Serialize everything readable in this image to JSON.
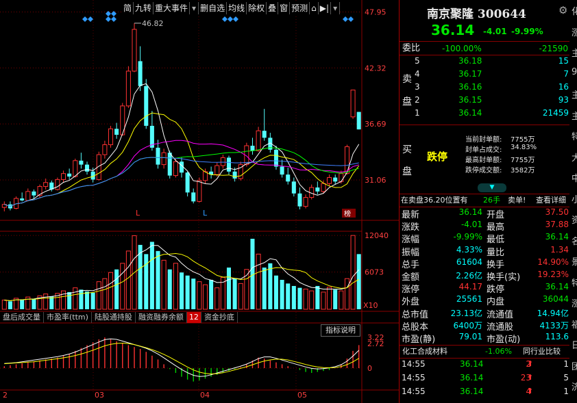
{
  "toolbar": {
    "items": [
      "简",
      "九转",
      "重大事件",
      "删自选",
      "均线",
      "除权",
      "叠",
      "窗",
      "预测"
    ]
  },
  "chart_data": {
    "type": "candlestick",
    "price_axis": {
      "labels": [
        "47.95",
        "42.32",
        "36.69",
        "31.06"
      ],
      "range": [
        27.0,
        48.6
      ]
    },
    "high_marker": "46.82",
    "volume_axis": {
      "labels": [
        "12040",
        "6073",
        "X10"
      ]
    },
    "indicator_axis": {
      "labels": [
        "3.22",
        "2.72",
        "0"
      ]
    },
    "x_labels": [
      "2",
      "03",
      "04",
      "05"
    ],
    "markers_L": [
      "L",
      "L"
    ],
    "corner_tag": "榜",
    "candles": [
      [
        28.3,
        28.9,
        27.9,
        28.6
      ],
      [
        28.6,
        28.9,
        28.0,
        28.2
      ],
      [
        28.2,
        29.4,
        28.1,
        29.2
      ],
      [
        29.2,
        29.8,
        28.9,
        29.0
      ],
      [
        29.0,
        30.2,
        28.9,
        29.9
      ],
      [
        29.9,
        30.1,
        29.2,
        29.5
      ],
      [
        29.5,
        30.6,
        29.3,
        30.4
      ],
      [
        30.4,
        31.2,
        30.1,
        30.8
      ],
      [
        30.8,
        31.0,
        29.9,
        30.1
      ],
      [
        30.1,
        31.3,
        30.0,
        31.1
      ],
      [
        31.1,
        32.0,
        30.8,
        31.7
      ],
      [
        31.7,
        32.2,
        31.1,
        31.4
      ],
      [
        31.4,
        33.2,
        31.3,
        33.0
      ],
      [
        33.0,
        33.8,
        32.2,
        32.6
      ],
      [
        32.6,
        32.9,
        31.6,
        31.9
      ],
      [
        31.9,
        32.3,
        30.8,
        31.1
      ],
      [
        31.1,
        33.9,
        31.0,
        33.6
      ],
      [
        33.6,
        35.0,
        33.2,
        34.6
      ],
      [
        34.6,
        36.5,
        34.3,
        36.2
      ],
      [
        36.2,
        36.8,
        35.2,
        35.6
      ],
      [
        35.6,
        38.8,
        35.5,
        38.5
      ],
      [
        38.5,
        42.5,
        38.3,
        42.0
      ],
      [
        42.0,
        46.82,
        41.9,
        46.2
      ],
      [
        43.0,
        44.5,
        40.0,
        40.5
      ],
      [
        40.5,
        41.2,
        36.2,
        36.5
      ],
      [
        36.5,
        38.0,
        34.0,
        34.3
      ],
      [
        34.3,
        35.1,
        32.2,
        32.6
      ],
      [
        32.6,
        34.2,
        32.2,
        33.8
      ],
      [
        33.8,
        34.0,
        31.2,
        31.5
      ],
      [
        31.5,
        33.2,
        31.3,
        32.9
      ],
      [
        32.9,
        33.3,
        31.3,
        31.8
      ],
      [
        31.8,
        31.9,
        29.4,
        29.8
      ],
      [
        29.8,
        30.2,
        28.7,
        28.9
      ],
      [
        28.9,
        31.3,
        28.8,
        31.0
      ],
      [
        31.0,
        32.2,
        30.7,
        31.9
      ],
      [
        31.9,
        32.4,
        31.2,
        31.6
      ],
      [
        31.6,
        32.8,
        31.4,
        32.5
      ],
      [
        32.5,
        33.6,
        32.2,
        33.3
      ],
      [
        33.3,
        33.5,
        31.6,
        31.9
      ],
      [
        31.9,
        32.3,
        30.9,
        31.2
      ],
      [
        31.2,
        32.9,
        31.0,
        32.6
      ],
      [
        32.6,
        34.8,
        32.4,
        34.5
      ],
      [
        34.5,
        35.3,
        33.6,
        34.0
      ],
      [
        34.0,
        36.4,
        33.9,
        36.0
      ],
      [
        36.0,
        38.2,
        35.0,
        35.3
      ],
      [
        35.3,
        35.8,
        33.8,
        34.1
      ],
      [
        34.1,
        34.5,
        32.1,
        32.4
      ],
      [
        32.4,
        33.1,
        31.3,
        31.6
      ],
      [
        31.6,
        32.3,
        30.6,
        30.9
      ],
      [
        30.9,
        31.3,
        29.4,
        29.7
      ],
      [
        29.7,
        30.3,
        28.1,
        28.4
      ],
      [
        28.4,
        29.6,
        28.2,
        29.3
      ],
      [
        29.3,
        30.6,
        29.1,
        30.3
      ],
      [
        30.3,
        30.9,
        29.6,
        29.9
      ],
      [
        29.9,
        31.0,
        29.7,
        30.7
      ],
      [
        30.7,
        31.6,
        30.4,
        31.3
      ],
      [
        31.3,
        31.6,
        30.6,
        30.9
      ],
      [
        30.9,
        32.0,
        30.7,
        31.7
      ],
      [
        31.7,
        34.6,
        31.6,
        34.4
      ],
      [
        37.4,
        40.1,
        37.2,
        40.1
      ],
      [
        37.9,
        37.9,
        36.14,
        36.14
      ]
    ],
    "volumes": [
      1500,
      1300,
      1800,
      1600,
      2000,
      1700,
      2200,
      2500,
      2100,
      2600,
      3000,
      2800,
      3500,
      3200,
      2900,
      2700,
      4500,
      5000,
      6000,
      6500,
      7500,
      9500,
      12000,
      10500,
      9000,
      11000,
      9500,
      8000,
      6500,
      7500,
      6000,
      5500,
      5000,
      4500,
      4000,
      4800,
      3500,
      5200,
      6800,
      5000,
      4200,
      6500,
      11500,
      9000,
      6800,
      7500,
      5500,
      4800,
      4200,
      3800,
      3500,
      3300,
      3000,
      3800,
      2800,
      3600,
      3200,
      3000,
      5000,
      12040,
      9000
    ],
    "ma_colors": [
      "#ffffff",
      "#ffff00",
      "#ff00ff",
      "#00ff00",
      "#4080ff"
    ],
    "macd": [
      0.2,
      0.3,
      0.4,
      0.5,
      0.6,
      0.7,
      0.8,
      0.9,
      1.0,
      1.1,
      1.3,
      1.5,
      1.8,
      2.1,
      2.4,
      2.7,
      3.0,
      3.2,
      3.0,
      2.8,
      2.6,
      2.4,
      2.2,
      2.0,
      1.7,
      1.3,
      0.9,
      0.4,
      -0.1,
      -0.5,
      -0.9,
      -1.2,
      -1.4,
      -1.3,
      -1.1,
      -0.9,
      -0.7,
      -0.5,
      -0.3,
      -0.1,
      0.1,
      0.4,
      0.8,
      1.1,
      1.0,
      0.8,
      0.6,
      0.4,
      0.2,
      0,
      -0.2,
      -0.4,
      -0.5,
      -0.4,
      -0.3,
      -0.2,
      0,
      0.4,
      1.0,
      1.8,
      2.4
    ]
  },
  "bottom_tabs": [
    "盘后成交量",
    "市盈率(ttm)",
    "陆股通持股",
    "融资融券余额",
    "12",
    "资金抄底"
  ],
  "indicator_button": "指标说明",
  "quote": {
    "name": "南京聚隆 300644",
    "price": "36.14",
    "change": "-4.01",
    "pct": "-9.99%",
    "weibi_label": "委比",
    "weibi_pct": "-100.00%",
    "weibi_diff": "-21590",
    "sell_label": [
      "卖",
      "盘"
    ],
    "sells": [
      [
        "5",
        "36.18",
        "15"
      ],
      [
        "4",
        "36.17",
        "7"
      ],
      [
        "3",
        "36.16",
        "16"
      ],
      [
        "2",
        "36.15",
        "93"
      ],
      [
        "1",
        "36.14",
        "21459"
      ]
    ],
    "buy_label": [
      "买",
      "盘"
    ],
    "limit_text": "跌停",
    "seal_info": [
      [
        "当前封单额:",
        "7755万"
      ],
      [
        "封单占成交:",
        "34.83%"
      ],
      [
        "最高封单额:",
        "7755万"
      ],
      [
        "跌停成交额:",
        "3582万"
      ]
    ],
    "outer_line": {
      "text": "在卖盘36.20位置有",
      "qty": "26手",
      "sell": "卖单!",
      "detail": "查看详细"
    },
    "stats": [
      [
        "最新",
        "36.14",
        "开盘",
        "37.50"
      ],
      [
        "涨跌",
        "-4.01",
        "最高",
        "37.88"
      ],
      [
        "涨幅",
        "-9.99%",
        "最低",
        "36.14"
      ],
      [
        "振幅",
        "4.33%",
        "量比",
        "1.34"
      ],
      [
        "总手",
        "61604",
        "换手",
        "14.90%"
      ],
      [
        "金额",
        "2.26亿",
        "换手(实)",
        "19.23%"
      ],
      [
        "涨停",
        "44.17",
        "跌停",
        "36.14"
      ],
      [
        "外盘",
        "25561",
        "内盘",
        "36044"
      ],
      [
        "总市值",
        "23.13亿",
        "流通值",
        "14.94亿"
      ],
      [
        "总股本",
        "6400万",
        "流通股",
        "4133万"
      ],
      [
        "市盈(静)",
        "79.01",
        "市盈(动)",
        "113.6"
      ]
    ],
    "industry": {
      "name": "化工合成材料",
      "pct": "-1.06%",
      "compare": "同行业比较"
    },
    "ticks": [
      [
        "14:55",
        "36.14",
        "2",
        "1"
      ],
      [
        "14:55",
        "36.14",
        "23",
        "5"
      ],
      [
        "14:55",
        "36.14",
        "4",
        "1"
      ]
    ],
    "side_chars": [
      "化",
      "涨",
      "主",
      "9",
      "主",
      "主",
      "特",
      "大",
      "中",
      "小",
      "资",
      "名",
      "景",
      "特",
      "涨",
      "福",
      "日",
      "团",
      "济"
    ]
  }
}
